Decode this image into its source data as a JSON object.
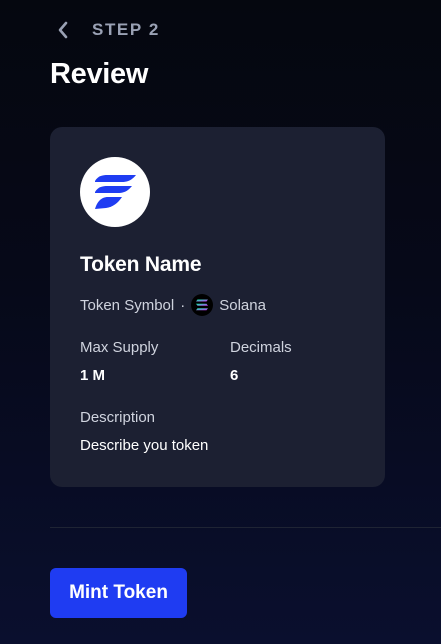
{
  "header": {
    "step_label": "STEP 2",
    "title": "Review",
    "back_icon": "chevron-left-icon"
  },
  "token": {
    "logo_icon": "stylized-f-logo-icon",
    "name": "Token Name",
    "symbol": "Token Symbol",
    "separator": "·",
    "network_icon": "solana-icon",
    "network": "Solana"
  },
  "stats": {
    "max_supply_label": "Max Supply",
    "max_supply_value": "1 M",
    "decimals_label": "Decimals",
    "decimals_value": "6"
  },
  "description": {
    "label": "Description",
    "value": "Describe you token"
  },
  "actions": {
    "mint_label": "Mint Token"
  },
  "colors": {
    "background": "#05070f",
    "card": "#1c2032",
    "accent": "#1f3cf2",
    "muted_text": "#9aa1b4"
  }
}
